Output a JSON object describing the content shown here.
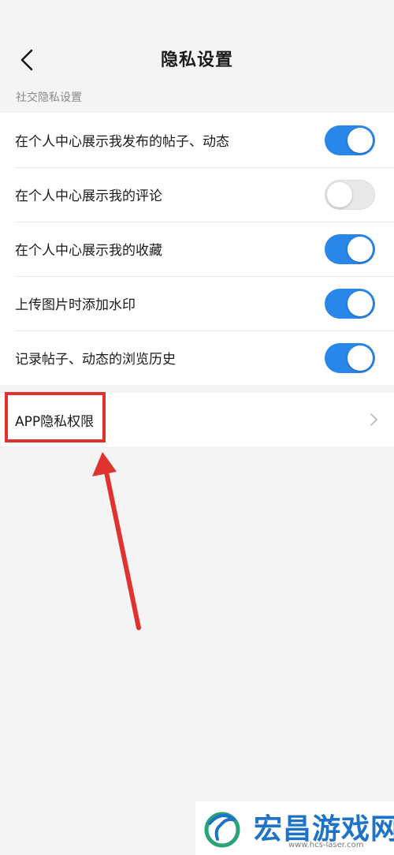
{
  "header": {
    "title": "隐私设置",
    "back_icon": "chevron-left-icon"
  },
  "section": {
    "label": "社交隐私设置"
  },
  "settings": [
    {
      "label": "在个人中心展示我发布的帖子、动态",
      "enabled": true
    },
    {
      "label": "在个人中心展示我的评论",
      "enabled": false
    },
    {
      "label": "在个人中心展示我的收藏",
      "enabled": true
    },
    {
      "label": "上传图片时添加水印",
      "enabled": true
    },
    {
      "label": "记录帖子、动态的浏览历史",
      "enabled": true
    }
  ],
  "app_privacy": {
    "label": "APP隐私权限",
    "chevron_icon": "chevron-right-icon"
  },
  "watermark": {
    "name": "宏昌游戏网",
    "url": "www.hcs-laser.com"
  },
  "colors": {
    "toggle_on": "#2a87ea",
    "toggle_off": "#e9e9e9",
    "highlight": "#e0322f",
    "watermark_text": "#1e73c7"
  }
}
